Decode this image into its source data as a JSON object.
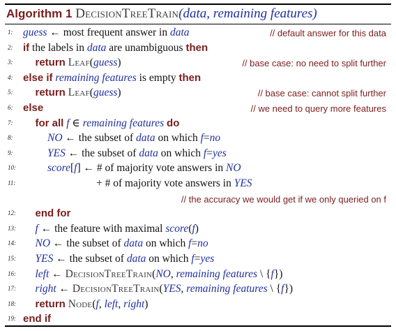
{
  "title": {
    "label": "Algorithm 1",
    "name": "DecisionTreeTrain",
    "args": "(data, remaining features)"
  },
  "lines": [
    {
      "num": "1:",
      "indent": 0,
      "parts": [
        [
          "v",
          "guess"
        ],
        [
          "t",
          " ← most frequent answer in "
        ],
        [
          "v",
          "data"
        ]
      ],
      "comment": "// default answer for this data"
    },
    {
      "num": "2:",
      "indent": 0,
      "parts": [
        [
          "k",
          "if"
        ],
        [
          "t",
          " the labels in "
        ],
        [
          "v",
          "data"
        ],
        [
          "t",
          " are unambiguous "
        ],
        [
          "k",
          "then"
        ]
      ]
    },
    {
      "num": "3:",
      "indent": 1,
      "parts": [
        [
          "k",
          "return"
        ],
        [
          "t",
          " "
        ],
        [
          "s",
          "Leaf"
        ],
        [
          "t",
          "("
        ],
        [
          "v",
          "guess"
        ],
        [
          "t",
          ")"
        ]
      ],
      "comment": "// base case: no need to split further"
    },
    {
      "num": "4:",
      "indent": 0,
      "parts": [
        [
          "k",
          "else if"
        ],
        [
          "t",
          " "
        ],
        [
          "v",
          "remaining features"
        ],
        [
          "t",
          " is empty "
        ],
        [
          "k",
          "then"
        ]
      ]
    },
    {
      "num": "5:",
      "indent": 1,
      "parts": [
        [
          "k",
          "return"
        ],
        [
          "t",
          " "
        ],
        [
          "s",
          "Leaf"
        ],
        [
          "t",
          "("
        ],
        [
          "v",
          "guess"
        ],
        [
          "t",
          ")"
        ]
      ],
      "comment": "// base case: cannot split further"
    },
    {
      "num": "6:",
      "indent": 0,
      "parts": [
        [
          "k",
          "else"
        ]
      ],
      "comment": "// we need to query more features"
    },
    {
      "num": "7:",
      "indent": 1,
      "parts": [
        [
          "k",
          "for all"
        ],
        [
          "t",
          " "
        ],
        [
          "v",
          "f"
        ],
        [
          "t",
          " ∈ "
        ],
        [
          "v",
          "remaining features"
        ],
        [
          "t",
          " "
        ],
        [
          "k",
          "do"
        ]
      ]
    },
    {
      "num": "8:",
      "indent": 2,
      "parts": [
        [
          "v",
          "NO"
        ],
        [
          "t",
          " ← the subset of "
        ],
        [
          "v",
          "data"
        ],
        [
          "t",
          " on which "
        ],
        [
          "v",
          "f"
        ],
        [
          "t",
          "="
        ],
        [
          "v",
          "no"
        ]
      ]
    },
    {
      "num": "9:",
      "indent": 2,
      "parts": [
        [
          "v",
          "YES"
        ],
        [
          "t",
          " ← the subset of "
        ],
        [
          "v",
          "data"
        ],
        [
          "t",
          " on which "
        ],
        [
          "v",
          "f"
        ],
        [
          "t",
          "="
        ],
        [
          "v",
          "yes"
        ]
      ]
    },
    {
      "num": "10:",
      "indent": 2,
      "parts": [
        [
          "v",
          "score"
        ],
        [
          "t",
          "["
        ],
        [
          "v",
          "f"
        ],
        [
          "t",
          "] ← # of majority vote answers in "
        ],
        [
          "v",
          "NO"
        ]
      ]
    },
    {
      "num": "11:",
      "indent": 6,
      "parts": [
        [
          "t",
          "+ # of majority vote answers in "
        ],
        [
          "v",
          "YES"
        ]
      ]
    },
    {
      "num": "",
      "indent": 0,
      "parts": [],
      "comment": "// the accuracy we would get if we only queried on f"
    },
    {
      "num": "12:",
      "indent": 1,
      "parts": [
        [
          "k",
          "end for"
        ]
      ]
    },
    {
      "num": "13:",
      "indent": 1,
      "parts": [
        [
          "v",
          "f"
        ],
        [
          "t",
          " ← the feature with maximal "
        ],
        [
          "v",
          "score"
        ],
        [
          "t",
          "("
        ],
        [
          "v",
          "f"
        ],
        [
          "t",
          ")"
        ]
      ]
    },
    {
      "num": "14:",
      "indent": 1,
      "parts": [
        [
          "v",
          "NO"
        ],
        [
          "t",
          " ← the subset of "
        ],
        [
          "v",
          "data"
        ],
        [
          "t",
          " on which "
        ],
        [
          "v",
          "f"
        ],
        [
          "t",
          "="
        ],
        [
          "v",
          "no"
        ]
      ]
    },
    {
      "num": "15:",
      "indent": 1,
      "parts": [
        [
          "v",
          "YES"
        ],
        [
          "t",
          " ← the subset of "
        ],
        [
          "v",
          "data"
        ],
        [
          "t",
          " on which "
        ],
        [
          "v",
          "f"
        ],
        [
          "t",
          "="
        ],
        [
          "v",
          "yes"
        ]
      ]
    },
    {
      "num": "16:",
      "indent": 1,
      "parts": [
        [
          "v",
          "left"
        ],
        [
          "t",
          " ← "
        ],
        [
          "s",
          "DecisionTreeTrain"
        ],
        [
          "t",
          "("
        ],
        [
          "v",
          "NO"
        ],
        [
          "t",
          ", "
        ],
        [
          "v",
          "remaining features"
        ],
        [
          "t",
          " \\ {"
        ],
        [
          "v",
          "f"
        ],
        [
          "t",
          "})"
        ]
      ]
    },
    {
      "num": "17:",
      "indent": 1,
      "parts": [
        [
          "v",
          "right"
        ],
        [
          "t",
          " ← "
        ],
        [
          "s",
          "DecisionTreeTrain"
        ],
        [
          "t",
          "("
        ],
        [
          "v",
          "YES"
        ],
        [
          "t",
          ", "
        ],
        [
          "v",
          "remaining features"
        ],
        [
          "t",
          " \\ {"
        ],
        [
          "v",
          "f"
        ],
        [
          "t",
          "})"
        ]
      ]
    },
    {
      "num": "18:",
      "indent": 1,
      "parts": [
        [
          "k",
          "return"
        ],
        [
          "t",
          " "
        ],
        [
          "s",
          "Node"
        ],
        [
          "t",
          "("
        ],
        [
          "v",
          "f"
        ],
        [
          "t",
          ", "
        ],
        [
          "v",
          "left"
        ],
        [
          "t",
          ", "
        ],
        [
          "v",
          "right"
        ],
        [
          "t",
          ")"
        ]
      ]
    },
    {
      "num": "19:",
      "indent": 0,
      "parts": [
        [
          "k",
          "end if"
        ]
      ]
    }
  ]
}
